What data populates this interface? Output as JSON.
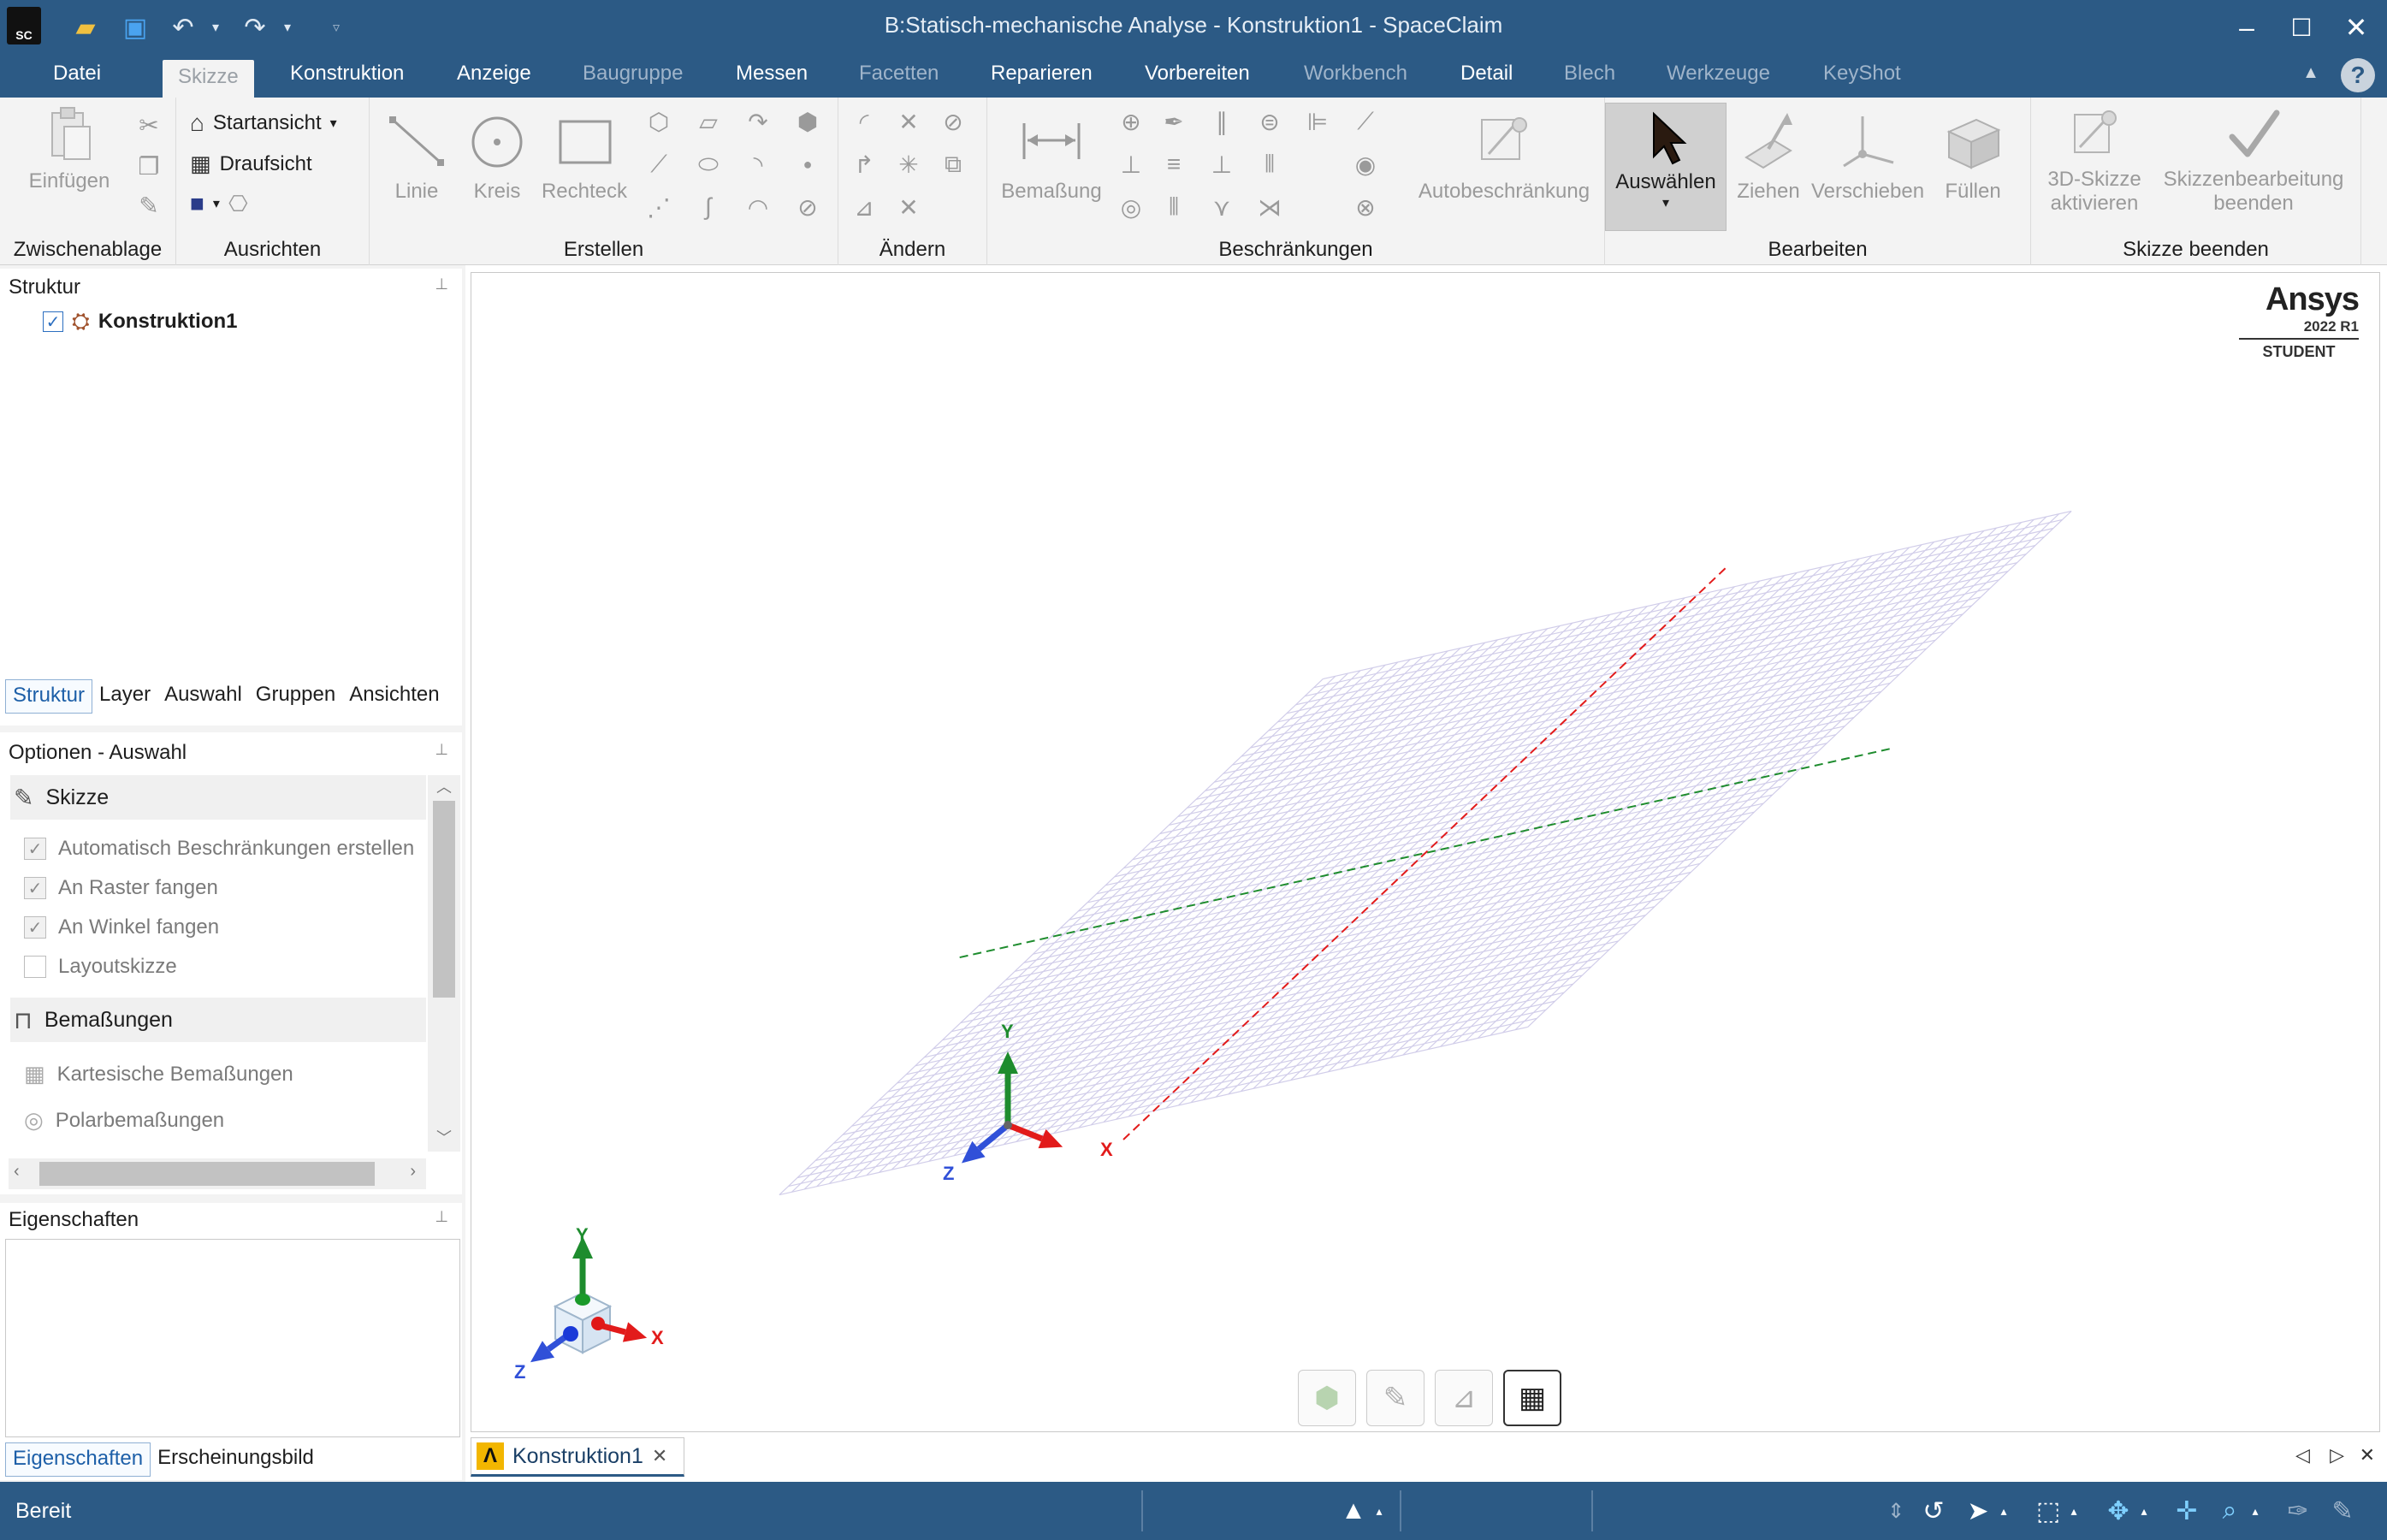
{
  "window": {
    "title": "B:Statisch-mechanische Analyse - Konstruktion1 - SpaceClaim",
    "app_icon_text": "SC"
  },
  "menu_tabs": [
    {
      "label": "Datei",
      "state": "normal"
    },
    {
      "label": "Skizze",
      "state": "active"
    },
    {
      "label": "Konstruktion",
      "state": "normal"
    },
    {
      "label": "Anzeige",
      "state": "normal"
    },
    {
      "label": "Baugruppe",
      "state": "dim"
    },
    {
      "label": "Messen",
      "state": "normal"
    },
    {
      "label": "Facetten",
      "state": "dim"
    },
    {
      "label": "Reparieren",
      "state": "normal"
    },
    {
      "label": "Vorbereiten",
      "state": "normal"
    },
    {
      "label": "Workbench",
      "state": "dim"
    },
    {
      "label": "Detail",
      "state": "normal"
    },
    {
      "label": "Blech",
      "state": "dim"
    },
    {
      "label": "Werkzeuge",
      "state": "dim"
    },
    {
      "label": "KeyShot",
      "state": "dim"
    }
  ],
  "ribbon": {
    "clipboard": {
      "group_label": "Zwischenablage",
      "paste": "Einfügen"
    },
    "orient": {
      "group_label": "Ausrichten",
      "home_view": "Startansicht",
      "top_view": "Draufsicht"
    },
    "create": {
      "group_label": "Erstellen",
      "line": "Linie",
      "circle": "Kreis",
      "rectangle": "Rechteck"
    },
    "modify": {
      "group_label": "Ändern"
    },
    "constraints": {
      "group_label": "Beschränkungen",
      "dimension": "Bemaßung",
      "auto_constraint": "Autobeschränkung"
    },
    "edit": {
      "group_label": "Bearbeiten",
      "select": "Auswählen",
      "pull": "Ziehen",
      "move": "Verschieben",
      "fill": "Füllen"
    },
    "end_sketch": {
      "group_label": "Skizze beenden",
      "activate_3d_line1": "3D-Skizze",
      "activate_3d_line2": "aktivieren",
      "end_edit_line1": "Skizzenbearbeitung",
      "end_edit_line2": "beenden"
    }
  },
  "structure_panel": {
    "title": "Struktur",
    "tree_root": "Konstruktion1",
    "tabs": [
      "Struktur",
      "Layer",
      "Auswahl",
      "Gruppen",
      "Ansichten"
    ]
  },
  "options_panel": {
    "title": "Optionen - Auswahl",
    "section_sketch": "Skizze",
    "sketch_options": [
      {
        "label": "Automatisch Beschränkungen erstellen",
        "checked": true
      },
      {
        "label": "An Raster fangen",
        "checked": true
      },
      {
        "label": "An Winkel fangen",
        "checked": true
      },
      {
        "label": "Layoutskizze",
        "checked": false
      }
    ],
    "section_dimensions": "Bemaßungen",
    "dimension_options": [
      "Kartesische Bemaßungen",
      "Polarbemaßungen"
    ]
  },
  "properties_panel": {
    "title": "Eigenschaften",
    "tabs": [
      "Eigenschaften",
      "Erscheinungsbild"
    ]
  },
  "viewport": {
    "brand": "Ansys",
    "version": "2022 R1",
    "edition": "STUDENT",
    "axis_x": "X",
    "axis_y": "Y",
    "axis_z": "Z"
  },
  "document_tab": {
    "label": "Konstruktion1"
  },
  "status_bar": {
    "status_text": "Bereit"
  },
  "colors": {
    "chrome": "#2c5a85",
    "ribbon": "#f3f3f3",
    "axis_x": "#e21b1b",
    "axis_y": "#1e8c2e",
    "axis_z": "#3050d8"
  }
}
